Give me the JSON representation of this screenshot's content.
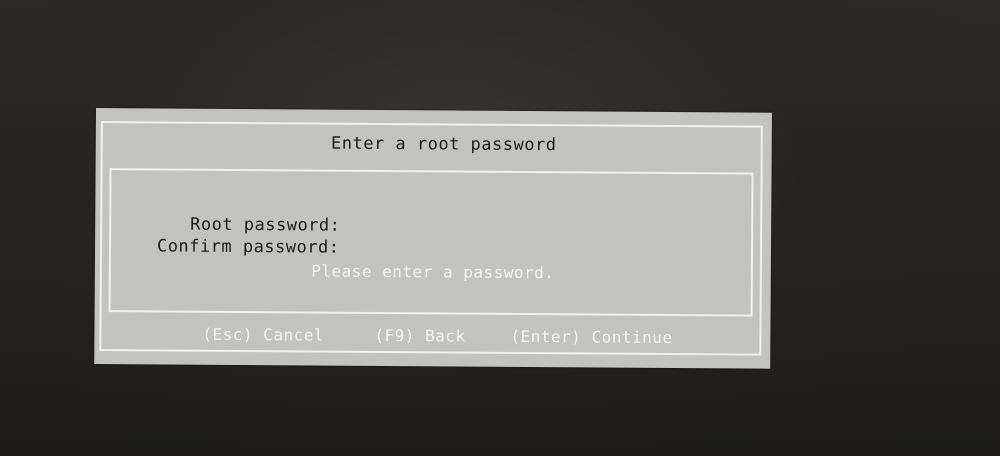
{
  "dialog": {
    "title": "Enter a root password",
    "fields": {
      "root_label": "Root password:",
      "confirm_label": "Confirm password:",
      "root_value": "",
      "confirm_value": ""
    },
    "message": "Please enter a password.",
    "keys": {
      "cancel": "(Esc) Cancel",
      "back": "(F9) Back",
      "continue": "(Enter) Continue"
    }
  },
  "colors": {
    "dialog_bg": "#c2c2bf",
    "border": "#f0f0ee",
    "text_dark": "#1c1c1c",
    "text_light": "#f4f4f2",
    "screen_bg": "#242220"
  }
}
